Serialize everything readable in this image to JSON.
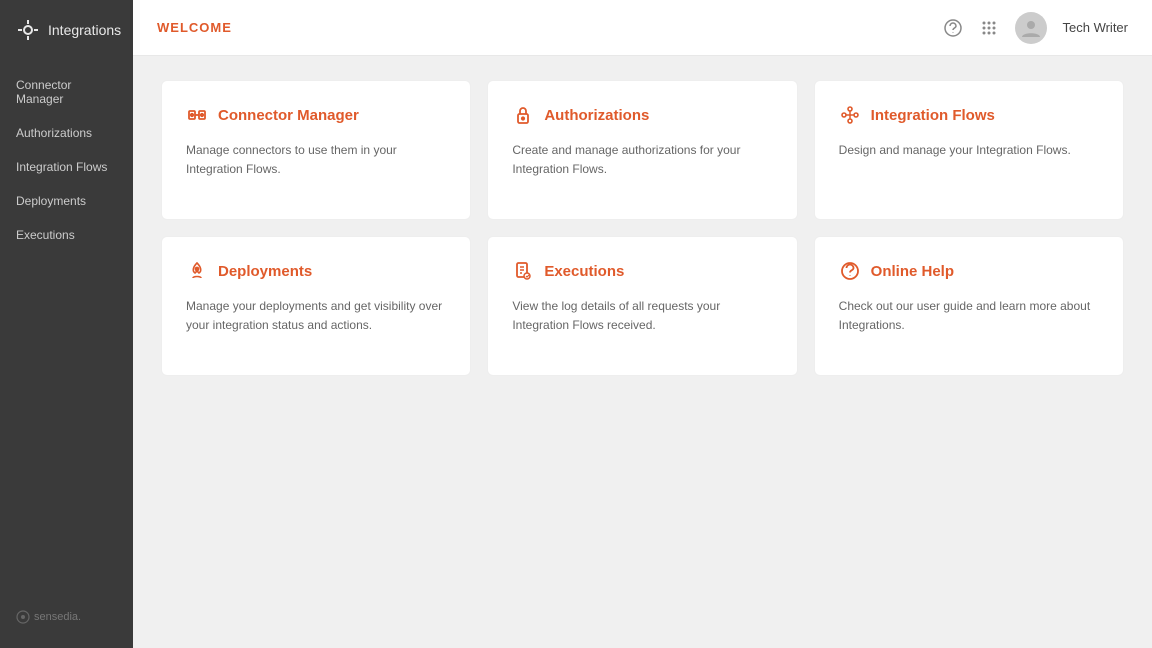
{
  "app": {
    "logo_text": "Integrations",
    "brand": "sensedia."
  },
  "sidebar": {
    "items": [
      {
        "id": "connector-manager",
        "label": "Connector Manager",
        "active": false
      },
      {
        "id": "authorizations",
        "label": "Authorizations",
        "active": false
      },
      {
        "id": "integration-flows",
        "label": "Integration Flows",
        "active": false
      },
      {
        "id": "deployments",
        "label": "Deployments",
        "active": false
      },
      {
        "id": "executions",
        "label": "Executions",
        "active": false
      }
    ]
  },
  "topbar": {
    "title": "WELCOME",
    "user_name": "Tech Writer"
  },
  "cards": [
    {
      "id": "connector-manager",
      "title": "Connector Manager",
      "description": "Manage connectors to use them in your Integration Flows.",
      "icon": "connector"
    },
    {
      "id": "authorizations",
      "title": "Authorizations",
      "description": "Create and manage authorizations for your Integration Flows.",
      "icon": "lock"
    },
    {
      "id": "integration-flows",
      "title": "Integration Flows",
      "description": "Design and manage your Integration Flows.",
      "icon": "flow"
    },
    {
      "id": "deployments",
      "title": "Deployments",
      "description": "Manage your deployments and get visibility over your integration status and actions.",
      "icon": "rocket"
    },
    {
      "id": "executions",
      "title": "Executions",
      "description": "View the log details of all requests your Integration Flows received.",
      "icon": "file"
    },
    {
      "id": "online-help",
      "title": "Online Help",
      "description": "Check out our user guide and learn more about Integrations.",
      "icon": "help"
    }
  ],
  "colors": {
    "accent": "#e05a2b",
    "sidebar_bg": "#3a3a3a",
    "main_bg": "#f0f0f0"
  }
}
